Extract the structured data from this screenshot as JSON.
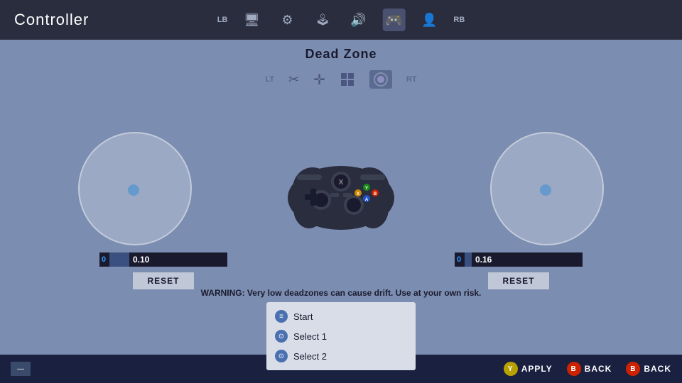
{
  "topbar": {
    "title": "Controller",
    "lb_label": "LB",
    "rb_label": "RB",
    "icons": [
      {
        "name": "monitor-icon",
        "symbol": "🖥",
        "active": false
      },
      {
        "name": "gear-icon",
        "symbol": "⚙",
        "active": false
      },
      {
        "name": "controller-icon",
        "symbol": "🎮",
        "active": true
      },
      {
        "name": "sound-icon",
        "symbol": "🔊",
        "active": false
      },
      {
        "name": "gamepad-icon",
        "symbol": "🎮",
        "active": false
      },
      {
        "name": "profile-icon",
        "symbol": "👤",
        "active": false
      }
    ]
  },
  "section": {
    "title": "Dead Zone",
    "tabs": [
      {
        "name": "lt-label",
        "label": "LT"
      },
      {
        "name": "scissors-icon",
        "symbol": "✂"
      },
      {
        "name": "move-icon",
        "symbol": "✛"
      },
      {
        "name": "grid-icon",
        "symbol": "⊞"
      },
      {
        "name": "circle-icon",
        "symbol": "⬤",
        "active": true
      },
      {
        "name": "rt-label",
        "label": "RT"
      }
    ]
  },
  "left_joystick": {
    "value": "0.10",
    "prefix": "0",
    "reset_label": "RESET"
  },
  "right_joystick": {
    "value": "0.16",
    "prefix": "0",
    "reset_label": "RESET"
  },
  "warning": {
    "text": "WARNING: Very low deadzones can cause drift. Use at your own risk."
  },
  "popup": {
    "items": [
      {
        "icon": "≡",
        "label": "Start"
      },
      {
        "icon": "⊙",
        "label": "Select 1"
      },
      {
        "icon": "⊙",
        "label": "Select 2"
      }
    ]
  },
  "bottom_bar": {
    "minus_label": "—",
    "apply_label": "APPLY",
    "back_label": "BACK",
    "btn_y": "Y",
    "btn_b": "B"
  }
}
